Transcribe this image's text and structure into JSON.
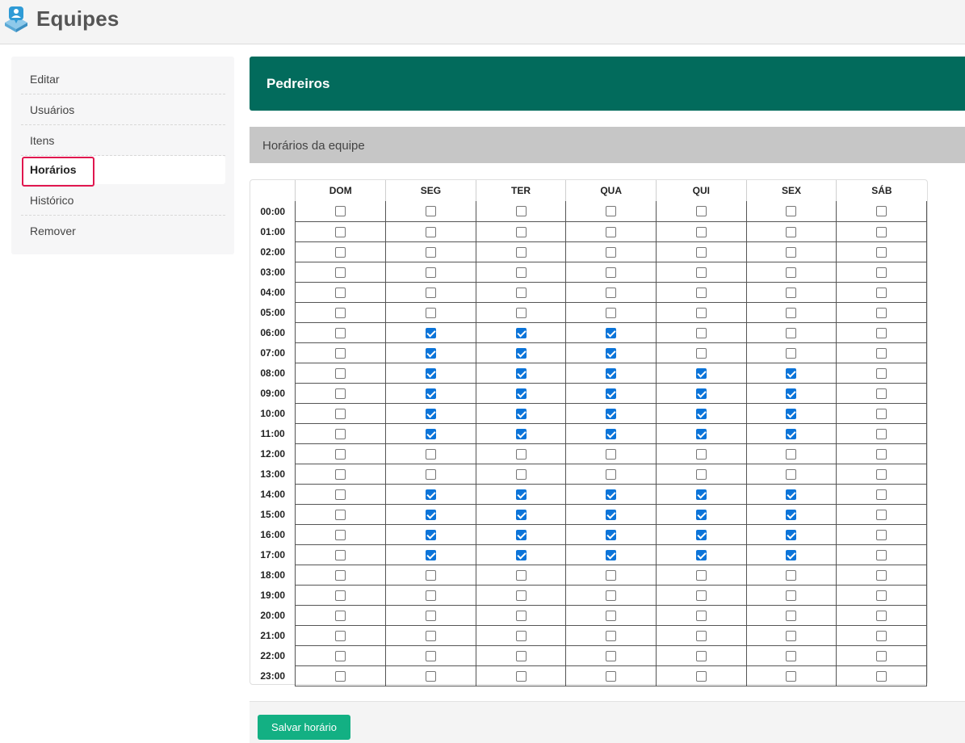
{
  "header": {
    "title": "Equipes",
    "logo_icon": "people-badge-icon"
  },
  "sidebar": {
    "items": [
      {
        "label": "Editar",
        "active": false
      },
      {
        "label": "Usuários",
        "active": false
      },
      {
        "label": "Itens",
        "active": false
      },
      {
        "label": "Horários",
        "active": true
      },
      {
        "label": "Histórico",
        "active": false
      },
      {
        "label": "Remover",
        "active": false
      }
    ],
    "highlight_color": "#e0174f"
  },
  "team": {
    "name": "Pedreiros",
    "banner_color": "#026b5c"
  },
  "section": {
    "title": "Horários da equipe"
  },
  "schedule": {
    "days": [
      "DOM",
      "SEG",
      "TER",
      "QUA",
      "QUI",
      "SEX",
      "SÁB"
    ],
    "hours": [
      "00:00",
      "01:00",
      "02:00",
      "03:00",
      "04:00",
      "05:00",
      "06:00",
      "07:00",
      "08:00",
      "09:00",
      "10:00",
      "11:00",
      "12:00",
      "13:00",
      "14:00",
      "15:00",
      "16:00",
      "17:00",
      "18:00",
      "19:00",
      "20:00",
      "21:00",
      "22:00",
      "23:00"
    ],
    "checked": [
      [
        0,
        0,
        0,
        0,
        0,
        0,
        0
      ],
      [
        0,
        0,
        0,
        0,
        0,
        0,
        0
      ],
      [
        0,
        0,
        0,
        0,
        0,
        0,
        0
      ],
      [
        0,
        0,
        0,
        0,
        0,
        0,
        0
      ],
      [
        0,
        0,
        0,
        0,
        0,
        0,
        0
      ],
      [
        0,
        0,
        0,
        0,
        0,
        0,
        0
      ],
      [
        0,
        1,
        1,
        1,
        0,
        0,
        0
      ],
      [
        0,
        1,
        1,
        1,
        0,
        0,
        0
      ],
      [
        0,
        1,
        1,
        1,
        1,
        1,
        0
      ],
      [
        0,
        1,
        1,
        1,
        1,
        1,
        0
      ],
      [
        0,
        1,
        1,
        1,
        1,
        1,
        0
      ],
      [
        0,
        1,
        1,
        1,
        1,
        1,
        0
      ],
      [
        0,
        0,
        0,
        0,
        0,
        0,
        0
      ],
      [
        0,
        0,
        0,
        0,
        0,
        0,
        0
      ],
      [
        0,
        1,
        1,
        1,
        1,
        1,
        0
      ],
      [
        0,
        1,
        1,
        1,
        1,
        1,
        0
      ],
      [
        0,
        1,
        1,
        1,
        1,
        1,
        0
      ],
      [
        0,
        1,
        1,
        1,
        1,
        1,
        0
      ],
      [
        0,
        0,
        0,
        0,
        0,
        0,
        0
      ],
      [
        0,
        0,
        0,
        0,
        0,
        0,
        0
      ],
      [
        0,
        0,
        0,
        0,
        0,
        0,
        0
      ],
      [
        0,
        0,
        0,
        0,
        0,
        0,
        0
      ],
      [
        0,
        0,
        0,
        0,
        0,
        0,
        0
      ],
      [
        0,
        0,
        0,
        0,
        0,
        0,
        0
      ]
    ],
    "check_color": "#0b74d9"
  },
  "footer": {
    "save_label": "Salvar horário",
    "save_color": "#13b083"
  }
}
